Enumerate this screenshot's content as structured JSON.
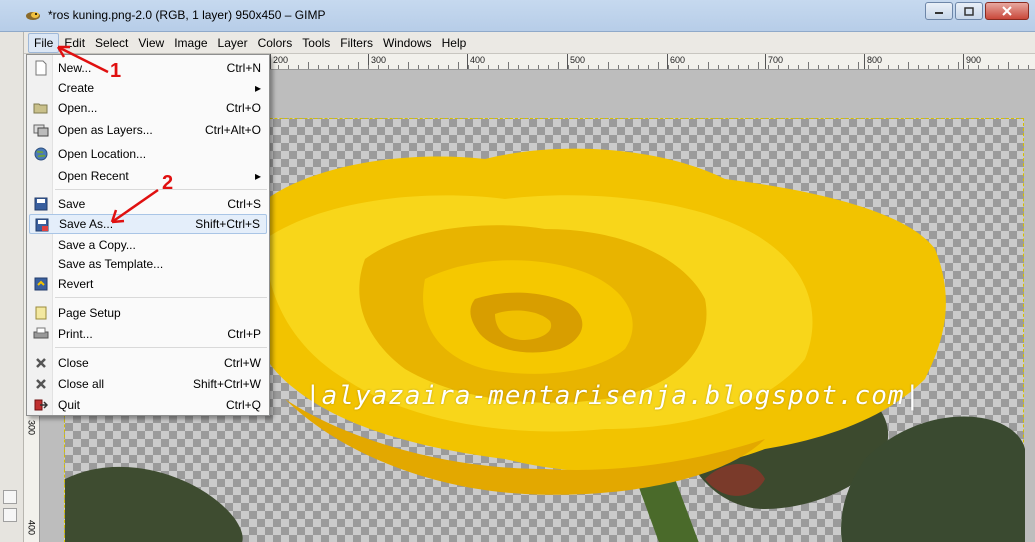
{
  "window": {
    "title": "*ros kuning.png-2.0 (RGB, 1 layer) 950x450 – GIMP",
    "icons": {
      "app": "gimp-wilber-icon",
      "minimize": "minimize-icon",
      "maximize": "maximize-icon",
      "close": "close-icon"
    }
  },
  "menubar": {
    "items": [
      "File",
      "Edit",
      "Select",
      "View",
      "Image",
      "Layer",
      "Colors",
      "Tools",
      "Filters",
      "Windows",
      "Help"
    ],
    "active": "File"
  },
  "ruler": {
    "h_labels": [
      "200",
      "300",
      "400",
      "500",
      "600",
      "700",
      "800",
      "900"
    ],
    "v_labels": [
      "300",
      "400"
    ]
  },
  "file_menu": {
    "items": [
      {
        "label": "New...",
        "shortcut": "Ctrl+N",
        "icon": "new-document-icon"
      },
      {
        "label": "Create",
        "submenu": true
      },
      {
        "label": "Open...",
        "shortcut": "Ctrl+O",
        "icon": "open-folder-icon"
      },
      {
        "label": "Open as Layers...",
        "shortcut": "Ctrl+Alt+O",
        "icon": "open-layers-icon"
      },
      {
        "label": "Open Location...",
        "icon": "globe-icon"
      },
      {
        "label": "Open Recent",
        "submenu": true
      },
      {
        "label": "Save",
        "shortcut": "Ctrl+S",
        "icon": "save-icon"
      },
      {
        "label": "Save As...",
        "shortcut": "Shift+Ctrl+S",
        "icon": "save-as-icon",
        "highlighted": true
      },
      {
        "label": "Save a Copy..."
      },
      {
        "label": "Save as Template..."
      },
      {
        "label": "Revert",
        "icon": "revert-icon"
      },
      {
        "label": "Page Setup",
        "icon": "page-setup-icon"
      },
      {
        "label": "Print...",
        "shortcut": "Ctrl+P",
        "icon": "print-icon"
      },
      {
        "label": "Close",
        "shortcut": "Ctrl+W",
        "icon": "close-x-icon"
      },
      {
        "label": "Close all",
        "shortcut": "Shift+Ctrl+W",
        "icon": "close-all-icon"
      },
      {
        "label": "Quit",
        "shortcut": "Ctrl+Q",
        "icon": "quit-icon"
      }
    ]
  },
  "canvas": {
    "watermark": "|alyazaira-mentarisenja.blogspot.com|"
  },
  "annotations": {
    "step1": "1",
    "step2": "2",
    "color": "#e01010"
  }
}
